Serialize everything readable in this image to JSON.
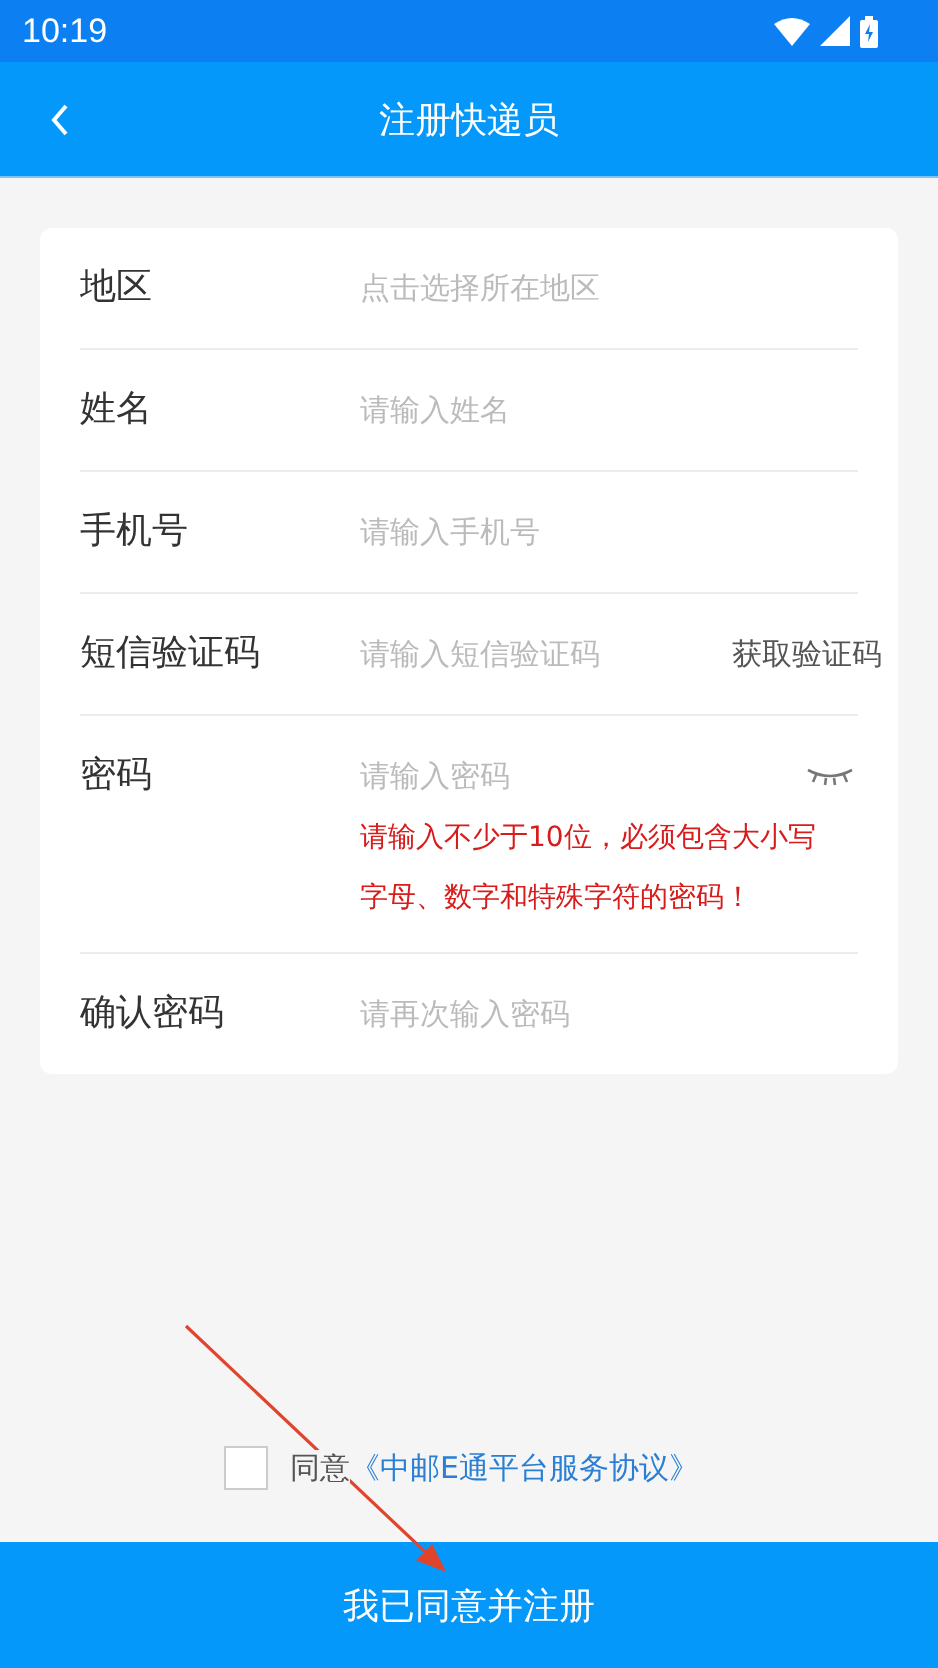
{
  "status_bar": {
    "time": "10:19"
  },
  "nav": {
    "title": "注册快递员"
  },
  "fields": [
    {
      "kind": "select",
      "label": "地区",
      "placeholder": "点击选择所在地区"
    },
    {
      "kind": "text",
      "label": "姓名",
      "placeholder": "请输入姓名"
    },
    {
      "kind": "text",
      "label": "手机号",
      "placeholder": "请输入手机号"
    },
    {
      "kind": "code",
      "label": "短信验证码",
      "placeholder": "请输入短信验证码",
      "action": "获取验证码"
    },
    {
      "kind": "password",
      "label": "密码",
      "placeholder": "请输入密码",
      "hint": "请输入不少于10位，必须包含大小写字母、数字和特殊字符的密码！"
    },
    {
      "kind": "text",
      "label": "确认密码",
      "placeholder": "请再次输入密码"
    }
  ],
  "agreement": {
    "checked": false,
    "text": "同意",
    "link": "《中邮E通平台服务协议》"
  },
  "submit": "我已同意并注册"
}
